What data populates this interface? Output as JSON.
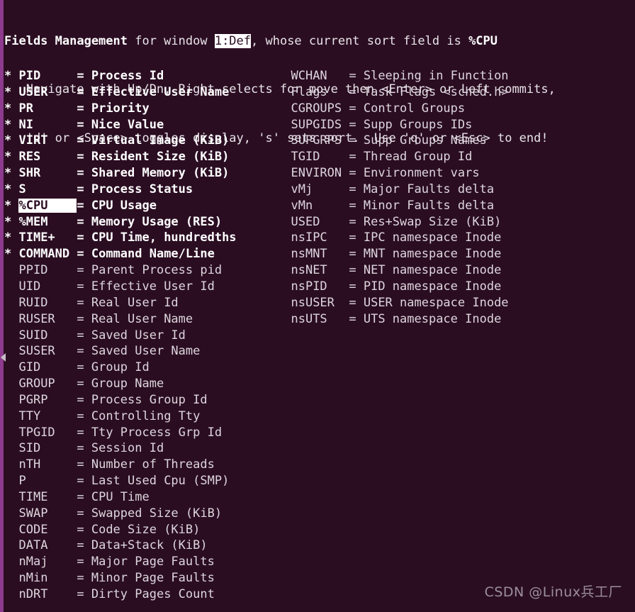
{
  "terminal": {
    "background_color": "#2b0d22",
    "foreground_color": "#e8e4e8",
    "highlight_bg_color": "#ffffff",
    "highlight_fg_color": "#2b0d22",
    "scrollbar_color": "#8e3a8e"
  },
  "header": {
    "line1_prefix": "Fields Management",
    "line1_mid": " for window ",
    "line1_window": "1:Def",
    "line1_suffix": ", whose current sort field is ",
    "line1_sortfield": "%CPU",
    "line2": "   Navigate with Up/Dn, Right selects for move then <Enter> or Left commits,",
    "line3": "   'd' or <Space> toggles display, 's' sets sort.  Use 'q' or <Esc> to end!"
  },
  "legend": {
    "enabled_marker": "*",
    "separator": "="
  },
  "left_column": [
    {
      "marker": "*",
      "name": "PID",
      "desc": "Process Id",
      "enabled": true,
      "selected": false
    },
    {
      "marker": "*",
      "name": "USER",
      "desc": "Effective User Name",
      "enabled": true,
      "selected": false
    },
    {
      "marker": "*",
      "name": "PR",
      "desc": "Priority",
      "enabled": true,
      "selected": false
    },
    {
      "marker": "*",
      "name": "NI",
      "desc": "Nice Value",
      "enabled": true,
      "selected": false
    },
    {
      "marker": "*",
      "name": "VIRT",
      "desc": "Virtual Image (KiB)",
      "enabled": true,
      "selected": false
    },
    {
      "marker": "*",
      "name": "RES",
      "desc": "Resident Size (KiB)",
      "enabled": true,
      "selected": false
    },
    {
      "marker": "*",
      "name": "SHR",
      "desc": "Shared Memory (KiB)",
      "enabled": true,
      "selected": false
    },
    {
      "marker": "*",
      "name": "S",
      "desc": "Process Status",
      "enabled": true,
      "selected": false
    },
    {
      "marker": "*",
      "name": "%CPU",
      "desc": "CPU Usage",
      "enabled": true,
      "selected": true
    },
    {
      "marker": "*",
      "name": "%MEM",
      "desc": "Memory Usage (RES)",
      "enabled": true,
      "selected": false
    },
    {
      "marker": "*",
      "name": "TIME+",
      "desc": "CPU Time, hundredths",
      "enabled": true,
      "selected": false
    },
    {
      "marker": "*",
      "name": "COMMAND",
      "desc": "Command Name/Line",
      "enabled": true,
      "selected": false
    },
    {
      "marker": " ",
      "name": "PPID",
      "desc": "Parent Process pid",
      "enabled": false,
      "selected": false
    },
    {
      "marker": " ",
      "name": "UID",
      "desc": "Effective User Id",
      "enabled": false,
      "selected": false
    },
    {
      "marker": " ",
      "name": "RUID",
      "desc": "Real User Id",
      "enabled": false,
      "selected": false
    },
    {
      "marker": " ",
      "name": "RUSER",
      "desc": "Real User Name",
      "enabled": false,
      "selected": false
    },
    {
      "marker": " ",
      "name": "SUID",
      "desc": "Saved User Id",
      "enabled": false,
      "selected": false
    },
    {
      "marker": " ",
      "name": "SUSER",
      "desc": "Saved User Name",
      "enabled": false,
      "selected": false
    },
    {
      "marker": " ",
      "name": "GID",
      "desc": "Group Id",
      "enabled": false,
      "selected": false
    },
    {
      "marker": " ",
      "name": "GROUP",
      "desc": "Group Name",
      "enabled": false,
      "selected": false
    },
    {
      "marker": " ",
      "name": "PGRP",
      "desc": "Process Group Id",
      "enabled": false,
      "selected": false
    },
    {
      "marker": " ",
      "name": "TTY",
      "desc": "Controlling Tty",
      "enabled": false,
      "selected": false
    },
    {
      "marker": " ",
      "name": "TPGID",
      "desc": "Tty Process Grp Id",
      "enabled": false,
      "selected": false
    },
    {
      "marker": " ",
      "name": "SID",
      "desc": "Session Id",
      "enabled": false,
      "selected": false
    },
    {
      "marker": " ",
      "name": "nTH",
      "desc": "Number of Threads",
      "enabled": false,
      "selected": false
    },
    {
      "marker": " ",
      "name": "P",
      "desc": "Last Used Cpu (SMP)",
      "enabled": false,
      "selected": false
    },
    {
      "marker": " ",
      "name": "TIME",
      "desc": "CPU Time",
      "enabled": false,
      "selected": false
    },
    {
      "marker": " ",
      "name": "SWAP",
      "desc": "Swapped Size (KiB)",
      "enabled": false,
      "selected": false
    },
    {
      "marker": " ",
      "name": "CODE",
      "desc": "Code Size (KiB)",
      "enabled": false,
      "selected": false
    },
    {
      "marker": " ",
      "name": "DATA",
      "desc": "Data+Stack (KiB)",
      "enabled": false,
      "selected": false
    },
    {
      "marker": " ",
      "name": "nMaj",
      "desc": "Major Page Faults",
      "enabled": false,
      "selected": false
    },
    {
      "marker": " ",
      "name": "nMin",
      "desc": "Minor Page Faults",
      "enabled": false,
      "selected": false
    },
    {
      "marker": " ",
      "name": "nDRT",
      "desc": "Dirty Pages Count",
      "enabled": false,
      "selected": false
    }
  ],
  "right_column": [
    {
      "marker": " ",
      "name": "WCHAN",
      "desc": "Sleeping in Function",
      "enabled": false,
      "selected": false
    },
    {
      "marker": " ",
      "name": "Flags",
      "desc": "Task Flags <sched.h>",
      "enabled": false,
      "selected": false
    },
    {
      "marker": " ",
      "name": "CGROUPS",
      "desc": "Control Groups",
      "enabled": false,
      "selected": false
    },
    {
      "marker": " ",
      "name": "SUPGIDS",
      "desc": "Supp Groups IDs",
      "enabled": false,
      "selected": false
    },
    {
      "marker": " ",
      "name": "SUPGRPS",
      "desc": "Supp Groups Names",
      "enabled": false,
      "selected": false
    },
    {
      "marker": " ",
      "name": "TGID",
      "desc": "Thread Group Id",
      "enabled": false,
      "selected": false
    },
    {
      "marker": " ",
      "name": "ENVIRON",
      "desc": "Environment vars",
      "enabled": false,
      "selected": false
    },
    {
      "marker": " ",
      "name": "vMj",
      "desc": "Major Faults delta",
      "enabled": false,
      "selected": false
    },
    {
      "marker": " ",
      "name": "vMn",
      "desc": "Minor Faults delta",
      "enabled": false,
      "selected": false
    },
    {
      "marker": " ",
      "name": "USED",
      "desc": "Res+Swap Size (KiB)",
      "enabled": false,
      "selected": false
    },
    {
      "marker": " ",
      "name": "nsIPC",
      "desc": "IPC namespace Inode",
      "enabled": false,
      "selected": false
    },
    {
      "marker": " ",
      "name": "nsMNT",
      "desc": "MNT namespace Inode",
      "enabled": false,
      "selected": false
    },
    {
      "marker": " ",
      "name": "nsNET",
      "desc": "NET namespace Inode",
      "enabled": false,
      "selected": false
    },
    {
      "marker": " ",
      "name": "nsPID",
      "desc": "PID namespace Inode",
      "enabled": false,
      "selected": false
    },
    {
      "marker": " ",
      "name": "nsUSER",
      "desc": "USER namespace Inode",
      "enabled": false,
      "selected": false
    },
    {
      "marker": " ",
      "name": "nsUTS",
      "desc": "UTS namespace Inode",
      "enabled": false,
      "selected": false
    }
  ],
  "watermark": {
    "text": "CSDN @Linux兵工厂"
  }
}
